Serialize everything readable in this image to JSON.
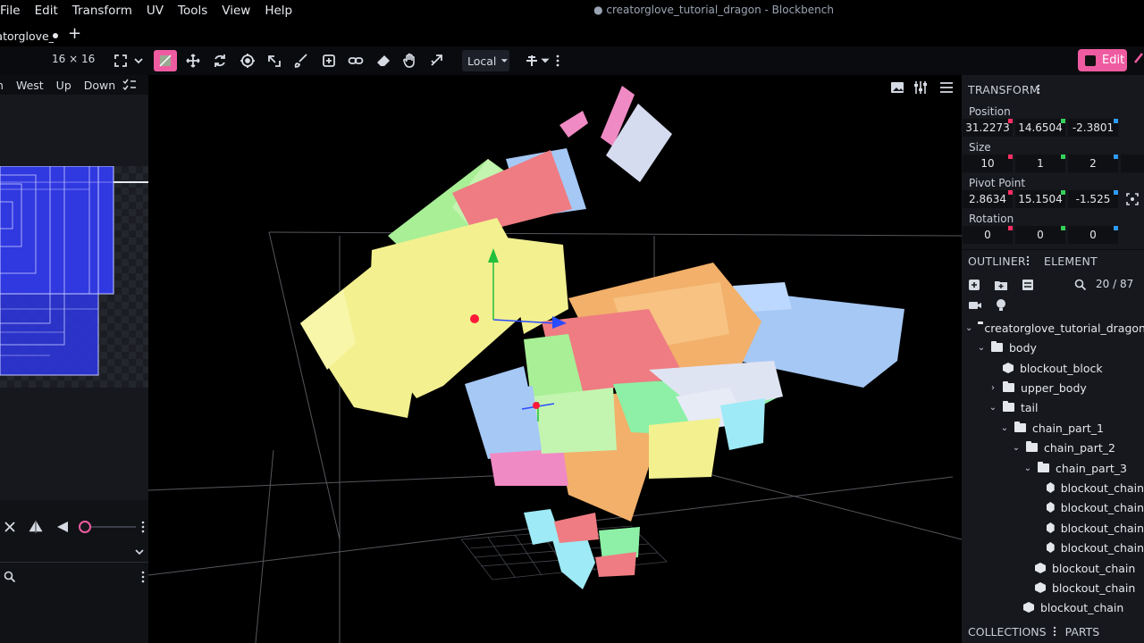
{
  "menubar": {
    "items": [
      "File",
      "Edit",
      "Transform",
      "UV",
      "Tools",
      "View",
      "Help"
    ],
    "window_title": "● creatorglove_tutorial_dragon - Blockbench"
  },
  "tabs": {
    "active_label": "creatorglove_tutorial_dragon",
    "add_tab_label": "+"
  },
  "toolbar": {
    "uv_size": "16 × 16",
    "local_value": "Local",
    "edit_mode": "Edit",
    "icons": [
      "fullscreen-icon",
      "vertex-snap-icon",
      "move-icon",
      "rotate-icon",
      "pivot-icon",
      "resize-icon",
      "brush-icon",
      "add-icon",
      "link-icon",
      "eraser-icon",
      "hand-icon",
      "stretch-icon",
      "transform-space-icon"
    ]
  },
  "uv_panel": {
    "faces": [
      "n",
      "West",
      "Up",
      "Down"
    ]
  },
  "transform": {
    "title": "TRANSFORM",
    "position_label": "Position",
    "position": [
      "31.2273",
      "14.6504",
      "-2.3801"
    ],
    "size_label": "Size",
    "size": [
      "10",
      "1",
      "2"
    ],
    "pivot_label": "Pivot Point",
    "pivot": [
      "2.8634",
      "15.1504",
      "-1.525"
    ],
    "rotation_label": "Rotation",
    "rotation": [
      "0",
      "0",
      "0"
    ],
    "axis_colors": [
      "#ff2e63",
      "#34d058",
      "#2e9bff"
    ]
  },
  "outliner": {
    "tab_outliner": "OUTLINER",
    "tab_element": "ELEMENT",
    "count": "20 / 87",
    "tree": [
      {
        "label": "creatorglove_tutorial_dragon",
        "type": "folder",
        "expanded": true
      },
      {
        "label": "body",
        "type": "folder",
        "expanded": true
      },
      {
        "label": "blockout_block",
        "type": "cube"
      },
      {
        "label": "upper_body",
        "type": "folder",
        "expanded": false
      },
      {
        "label": "tail",
        "type": "folder",
        "expanded": true
      },
      {
        "label": "chain_part_1",
        "type": "folder",
        "expanded": true
      },
      {
        "label": "chain_part_2",
        "type": "folder",
        "expanded": true
      },
      {
        "label": "chain_part_3",
        "type": "folder",
        "expanded": true
      },
      {
        "label": "blockout_chain",
        "type": "cube"
      },
      {
        "label": "blockout_chain",
        "type": "cube"
      },
      {
        "label": "blockout_chain",
        "type": "cube"
      },
      {
        "label": "blockout_chain",
        "type": "cube"
      },
      {
        "label": "blockout_chain",
        "type": "cube"
      },
      {
        "label": "blockout_chain",
        "type": "cube"
      },
      {
        "label": "blockout_chain",
        "type": "cube"
      }
    ]
  },
  "bottom_tabs": [
    "COLLECTIONS",
    "PARTS"
  ],
  "colors": {
    "accent": "#ef5ba1",
    "panel": "#16181d",
    "uv_blue": "#2d34d6"
  }
}
